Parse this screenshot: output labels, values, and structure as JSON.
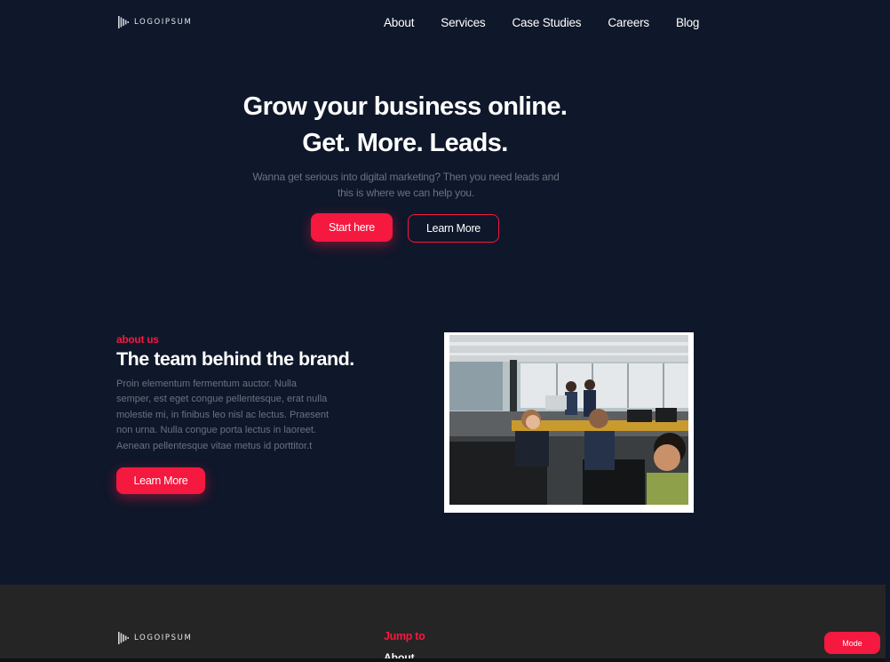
{
  "header": {
    "logo_text": "LOGOIPSUM",
    "nav": [
      {
        "label": "About"
      },
      {
        "label": "Services"
      },
      {
        "label": "Case Studies"
      },
      {
        "label": "Careers"
      },
      {
        "label": "Blog"
      }
    ]
  },
  "hero": {
    "title_line1": "Grow your business online.",
    "title_line2": "Get. More. Leads.",
    "subtitle_line1": "Wanna get serious into digital marketing? Then you need leads and",
    "subtitle_line2": "this is where we can help you.",
    "primary_button": "Start here",
    "secondary_button": "Learn More"
  },
  "about": {
    "eyebrow": "about us",
    "title": "The team behind the brand.",
    "body_lines": [
      "Proin elementum fermentum auctor. Nulla",
      "semper, est eget congue pellentesque, erat nulla",
      "molestie mi, in finibus leo nisl ac lectus. Praesent",
      "non urna. Nulla congue porta lectus in laoreet.",
      "Aenean pellentesque vitae metus id porttitor.t"
    ],
    "button": "Learn More"
  },
  "footer": {
    "logo_text": "LOGOIPSUM",
    "jump_heading": "Jump to",
    "links": [
      {
        "label": "About"
      }
    ]
  },
  "mode_button": "Mode",
  "colors": {
    "background": "#0f172a",
    "accent": "#f5183f",
    "muted_text": "#6b7280",
    "footer_bg": "#252525"
  },
  "icons": {
    "logo": "logo-mark-icon"
  }
}
